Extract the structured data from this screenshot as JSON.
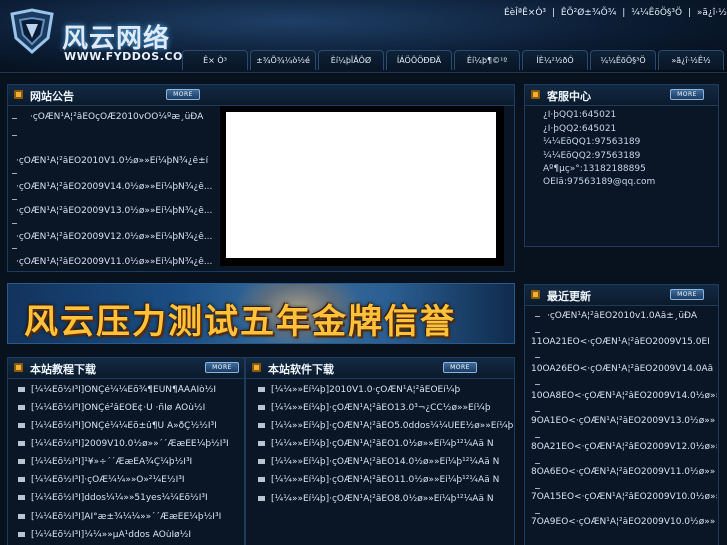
{
  "header": {
    "site_name": "风云网络",
    "site_url": "WWW.FYDDOS.COM",
    "top_links": [
      "ÉèÎªÊ×Ò³",
      "|",
      "ÊÕ²Ø±¾Õ¾",
      "|",
      "¼¼ÊõÖ§³Ö",
      "|",
      "»ã¿î·½Ê½"
    ]
  },
  "nav": {
    "tabs": [
      "Ê× Ò³",
      "±¾Õ¾¼ò½é",
      "Èí¼þÏÂÔØ",
      "ÍÁÖÔÖÐÐÄ",
      "Èí¼þ¶©¹º",
      "ÍÈ¼²½ðÓ",
      "¼¼ÊõÖ§³Ö",
      "»ã¿î·½Ê½"
    ]
  },
  "notice": {
    "title": "网站公告",
    "more": "MORE",
    "items": [
      "·çÔÆÑ¹Á¦²âÊÔçÔÆ2010vÕÒ¼ºæ¸üÐÂ",
      "·çÔÆÑ¹Á¦²âÊÔ2010V1.0½ø»»Èí¼þÑ¾¿ê±í",
      "·çÔÆÑ¹Á¦²âÊÔ2009V14.0½ø»»Èí¼þÑ¾¿ê...",
      "·çÔÆÑ¹Á¦²âÊÔ2009V13.0½ø»»Èí¼þÑ¾¿ê...",
      "·çÔÆÑ¹Á¦²âÊÔ2009V12.0½ø»»Èí¼þÑ¾¿ê...",
      "·çÔÆÑ¹Á¦²âÊÔ2009V11.0½ø»»Èí¼þÑ¾¿ê..."
    ]
  },
  "service": {
    "title": "客服中心",
    "more": "MORE",
    "lines": [
      "¿Í·þQQ1:645021",
      "¿Í·þQQ2:645021",
      "¼¼ÊõQQ1:97563189",
      "¼¼ÊõQQ2:97563189",
      "Àº¶µç»°:13182188895",
      "ÓÊÏä:97563189@qq.com"
    ]
  },
  "banner": {
    "text": "风云压力测试五年金牌信誉"
  },
  "tutorials": {
    "title": "本站教程下载",
    "more": "MORE",
    "items": [
      "[¼¼Êõ½Ì³Ì]ÖÑÇé¼¼Êõ¾­¶ÈÜÑ¶ÅÂÀÍò½Ì",
      "[¼¼Êõ½Ì³Ì]ÖÑÇé²âÊÔÊ¢·Ù ·ñÌø ÀÓù½Ì",
      "[¼¼Êõ½Ì³Ì]ÖÑÇé¼¼Êõ±û¶Ù À»ðÇ½½Ì³Ì",
      "[¼¼Êõ½Ì³Ì]2009V10.0½ø»»´´ÆæÈË¼þ½Ì³Ì",
      "[¼¼Êõ½Ì³Ì]¹¥»÷´´ÆæÈÀ¾Ç¼þ½Ì³Ì",
      "[¼¼Êõ½Ì³Ì]·çÔÆ¼¼»»Ö»²¼Ê½Ì³Ì",
      "[¼¼Êõ½Ì³Ì]ddos¼¼»»51yes¼¼Êõ½Ì³Ì",
      "[¼¼Êõ½Ì³Ì]ÂÎ°æ±¾¼¼»»´´ÆæÈË¼þ½Ì³Ì",
      "[¼¼Êõ½Ì³Ì]¼¼»»µÄ¹ddos ÀÓùÌø½Ì"
    ]
  },
  "software": {
    "title": "本站软件下载",
    "more": "MORE",
    "items": [
      "[¼¼»»Èí¼þ]2010V1.0·çÔÆÑ¹Á¦²âÊÔÈí¼þ",
      "[¼¼»»Èí¼þ]·çÔÆÑ¹Á¦²âÊÔ13.0³¬¿CC½ø»»Èí¼þ",
      "[¼¼»»Èí¼þ]·çÔÆÑ¹Á¦²âÊÔ5.0ddos¼¼ÜÈÊ½ø»»Èí¼þ",
      "[¼¼»»Èí¼þ]·çÔÆÑ¹Á¦²âÊÔ1.0½ø»»Èí¼þ¹²¼Âä Ñ",
      "[¼¼»»Èí¼þ]·çÔÆÑ¹Á¦²âÊÔ14.0½ø»»Èí¼þ¹²¼Âä Ñ",
      "[¼¼»»Èí¼þ]·çÔÆÑ¹Á¦²âÊÔ11.0½ø»»Èí¼þ¹²¼Âä Ñ",
      "[¼¼»»Èí¼þ]·çÔÆÑ¹Á¦²âÊÔ8.0½ø»»Èí¼þ¹²¼Âä Ñ"
    ]
  },
  "updates": {
    "title": "最近更新",
    "more": "MORE",
    "items": [
      "·çÔÆÑ¹Á¦²âÊÔ2010v1.0Ãâ±¸üÐÂ",
      "11ÔÂ21ÈÕ<·çÔÆÑ¹Á¦²âÊÔ2009V15.0ÈÍ",
      "10ÔÂ26ÈÕ<·çÔÆÑ¹Á¦²âÊÔ2009V14.0Ãâ",
      "10ÔÂ8ÈÕ<·çÔÆÑ¹Á¦²âÊÔ2009V14.0½ø»»",
      "9ÔÂ1ÈÕ<·çÔÆÑ¹Á¦²âÊÔ2009V13.0½ø»»",
      "8ÔÂ21ÈÕ<·çÔÆÑ¹Á¦²âÊÔ2009V12.0½ø»»",
      "8ÔÂ6ÈÕ<·çÔÆÑ¹Á¦²âÊÔ2009V11.0½ø»»",
      "7ÔÂ15ÈÕ<·çÔÆÑ¹Á¦²âÊÔ2009V10.0½ø»»",
      "7ÔÂ9ÈÕ<·çÔÆÑ¹Á¦²âÊÔ2009V10.0½ø»»"
    ]
  }
}
